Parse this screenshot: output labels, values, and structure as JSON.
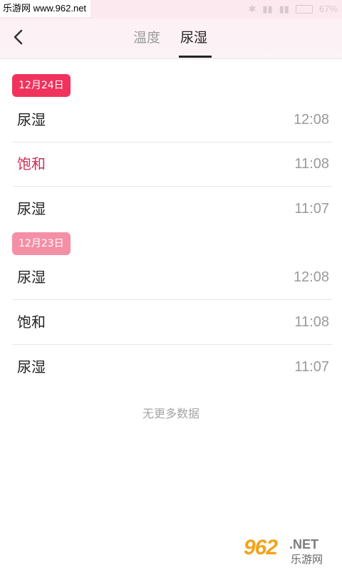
{
  "status_bar": {
    "watermark": "乐游网 www.962.net",
    "battery": "67%"
  },
  "header": {
    "tabs": [
      {
        "label": "温度",
        "active": false
      },
      {
        "label": "尿湿",
        "active": true
      }
    ]
  },
  "groups": [
    {
      "date": "12月24日",
      "badge_color": "#f0335d",
      "items": [
        {
          "label": "尿湿",
          "time": "12:08",
          "alert": false
        },
        {
          "label": "饱和",
          "time": "11:08",
          "alert": true
        },
        {
          "label": "尿湿",
          "time": "11:07",
          "alert": false
        }
      ]
    },
    {
      "date": "12月23日",
      "badge_color": "#f48fa6",
      "items": [
        {
          "label": "尿湿",
          "time": "12:08",
          "alert": false
        },
        {
          "label": "饱和",
          "time": "11:08",
          "alert": false
        },
        {
          "label": "尿湿",
          "time": "11:07",
          "alert": false
        }
      ]
    }
  ],
  "footer": {
    "no_more": "无更多数据"
  },
  "watermark_bottom": {
    "brand": "962",
    "suffix": ".NET",
    "sub": "乐游网"
  }
}
